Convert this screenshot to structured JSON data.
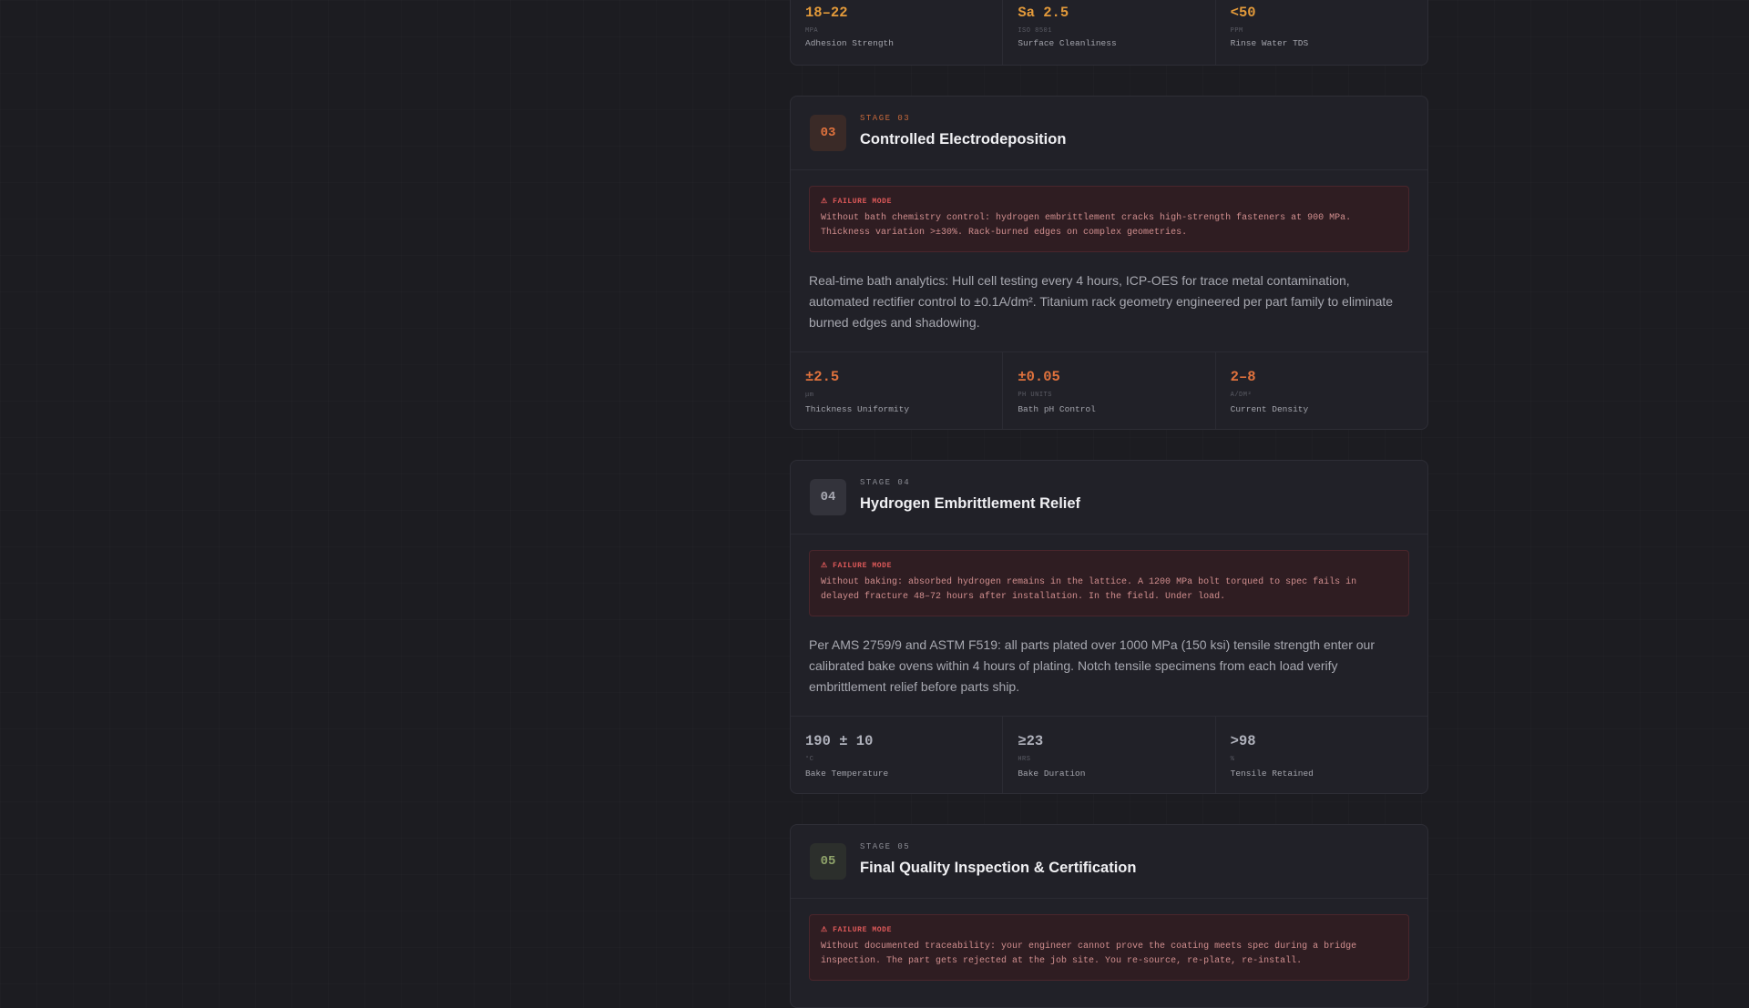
{
  "stage02_metrics": [
    {
      "value": "18–22",
      "unit": "MPA",
      "label": "Adhesion Strength"
    },
    {
      "value": "Sa 2.5",
      "unit": "ISO 8501",
      "label": "Surface Cleanliness"
    },
    {
      "value": "<50",
      "unit": "PPM",
      "label": "Rinse Water TDS"
    }
  ],
  "stages": [
    {
      "number": "03",
      "stage_label": "STAGE 03",
      "title": "Controlled Electrodeposition",
      "failure_label": "⚠ FAILURE MODE",
      "failure_text": "Without bath chemistry control: hydrogen embrittlement cracks high-strength fasteners at 900 MPa. Thickness variation >±30%. Rack-burned edges on complex geometries.",
      "description": "Real-time bath analytics: Hull cell testing every 4 hours, ICP-OES for trace metal contamination, automated rectifier control to ±0.1A/dm². Titanium rack geometry engineered per part family to eliminate burned edges and shadowing.",
      "metrics": [
        {
          "value": "±2.5",
          "unit": "μm",
          "label": "Thickness Uniformity"
        },
        {
          "value": "±0.05",
          "unit": "PH UNITS",
          "label": "Bath pH Control"
        },
        {
          "value": "2–8",
          "unit": "A/DM²",
          "label": "Current Density"
        }
      ]
    },
    {
      "number": "04",
      "stage_label": "STAGE 04",
      "title": "Hydrogen Embrittlement Relief",
      "failure_label": "⚠ FAILURE MODE",
      "failure_text": "Without baking: absorbed hydrogen remains in the lattice. A 1200 MPa bolt torqued to spec fails in delayed fracture 48–72 hours after installation. In the field. Under load.",
      "description": "Per AMS 2759/9 and ASTM F519: all parts plated over 1000 MPa (150 ksi) tensile strength enter our calibrated bake ovens within 4 hours of plating. Notch tensile specimens from each load verify embrittlement relief before parts ship.",
      "metrics": [
        {
          "value": "190 ± 10",
          "unit": "°C",
          "label": "Bake Temperature"
        },
        {
          "value": "≥23",
          "unit": "HRS",
          "label": "Bake Duration"
        },
        {
          "value": ">98",
          "unit": "%",
          "label": "Tensile Retained"
        }
      ]
    },
    {
      "number": "05",
      "stage_label": "STAGE 05",
      "title": "Final Quality Inspection & Certification",
      "failure_label": "⚠ FAILURE MODE",
      "failure_text": "Without documented traceability: your engineer cannot prove the coating meets spec during a bridge inspection. The part gets rejected at the job site. You re-source, re-plate, re-install."
    }
  ]
}
